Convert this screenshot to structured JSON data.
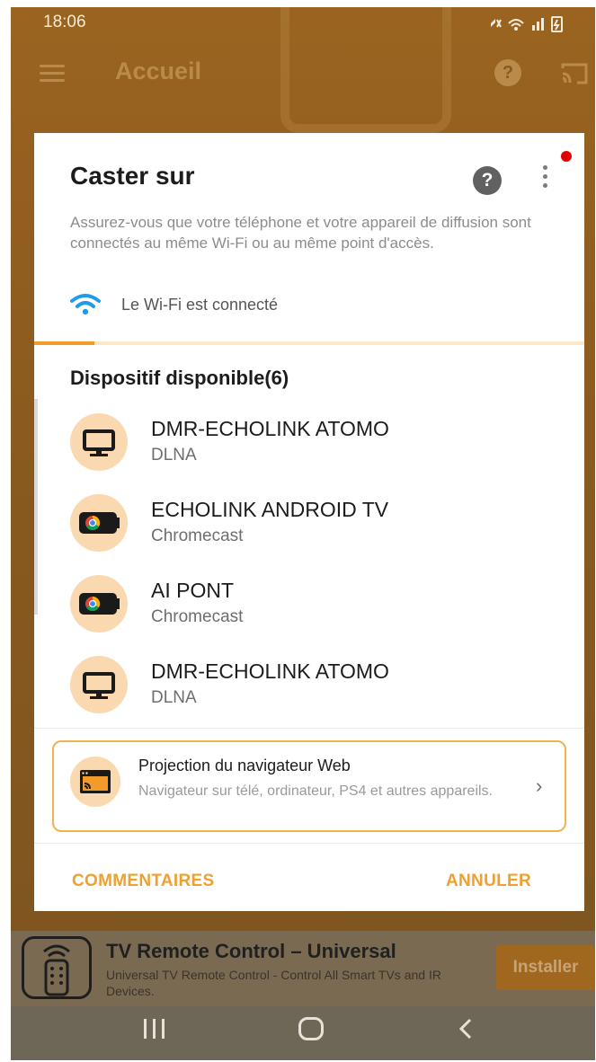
{
  "status_bar": {
    "time": "18:06",
    "icons": "mute-icon wifi-icon signal-icon battery-icon"
  },
  "app_bar": {
    "title": "Accueil"
  },
  "dialog": {
    "title": "Caster sur",
    "description": "Assurez-vous que votre téléphone et votre appareil de diffusion sont connectés au même Wi-Fi ou au même point d'accès.",
    "wifi_status": "Le Wi-Fi est connecté",
    "scan_progress": 0.11,
    "section_title": "Dispositif disponible(6)",
    "devices": [
      {
        "name": "DMR-ECHOLINK ATOMO",
        "type": "DLNA",
        "icon": "tv-icon"
      },
      {
        "name": "ECHOLINK ANDROID TV",
        "type": "Chromecast",
        "icon": "chromecast-icon"
      },
      {
        "name": "AI PONT",
        "type": "Chromecast",
        "icon": "chromecast-icon"
      },
      {
        "name": "DMR-ECHOLINK ATOMO",
        "type": "DLNA",
        "icon": "tv-icon"
      }
    ],
    "web_cast": {
      "title": "Projection du navigateur Web",
      "description": "Navigateur sur télé, ordinateur, PS4 et autres appareils.",
      "chevron": "›"
    },
    "buttons": {
      "comments": "COMMENTAIRES",
      "cancel": "ANNULER"
    }
  },
  "ad_banner": {
    "title": "TV Remote Control – Universal",
    "description": "Universal TV Remote Control - Control All Smart TVs and IR Devices.",
    "install_label": "Installer"
  },
  "colors": {
    "accent": "#f0a030",
    "icon_bg": "#fbd9b0",
    "wifi_blue": "#1e9be9"
  }
}
